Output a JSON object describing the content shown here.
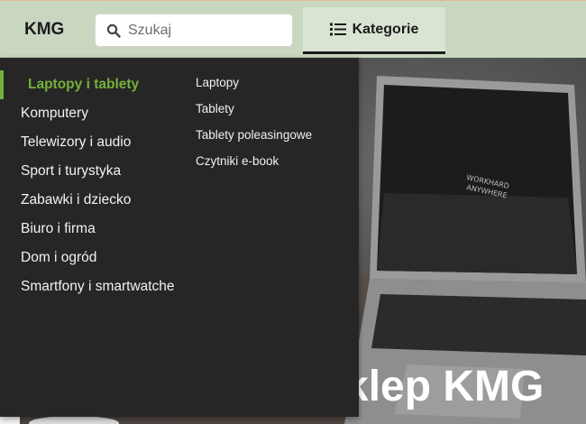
{
  "header": {
    "logo": "KMG",
    "search_placeholder": "Szukaj",
    "categories_button": "Kategorie"
  },
  "hero": {
    "title": "klep KMG"
  },
  "menu": {
    "categories": [
      "Laptopy i tablety",
      "Komputery",
      "Telewizory i audio",
      "Sport i turystyka",
      "Zabawki i dziecko",
      "Biuro i firma",
      "Dom i ogród",
      "Smartfony i smartwatche"
    ],
    "active_index": 0,
    "subcategories": [
      "Laptopy",
      "Tablety",
      "Tablety poleasingowe",
      "Czytniki e-book"
    ]
  },
  "colors": {
    "header_bg": "#c9d7c1",
    "menu_bg": "#262626",
    "accent_green": "#74b13a"
  },
  "icons": {
    "search": "search-icon",
    "categories": "list-icon",
    "hero": "laptop-icon"
  }
}
